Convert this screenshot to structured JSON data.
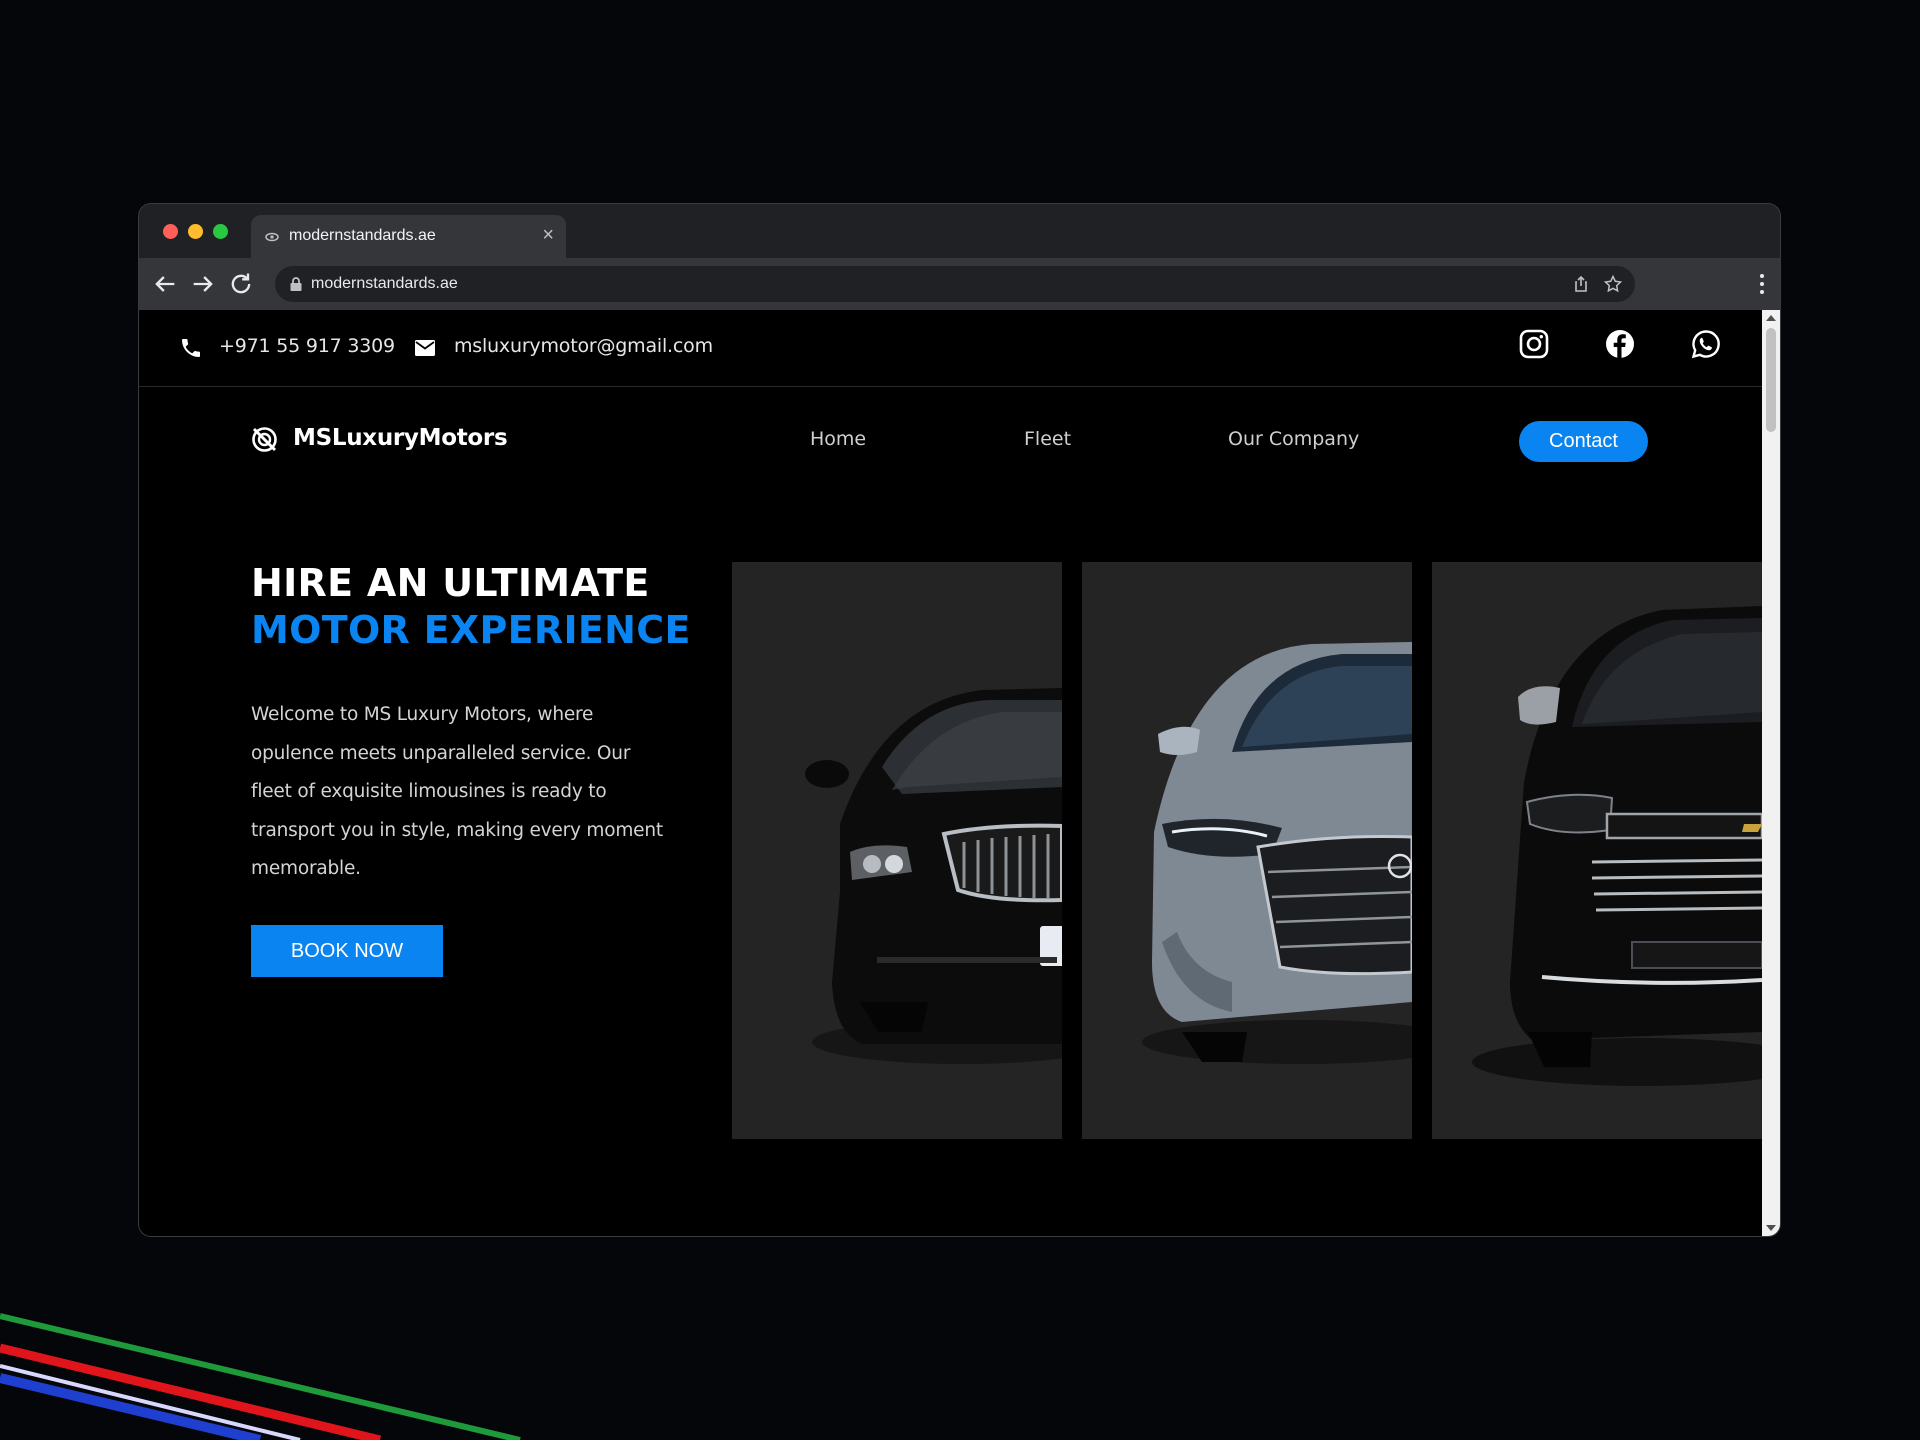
{
  "browser": {
    "tab_title": "modernstandards.ae",
    "url": "modernstandards.ae"
  },
  "topbar": {
    "phone": "+971 55 917 3309",
    "email": "msluxurymotor@gmail.com",
    "socials": [
      "instagram-icon",
      "facebook-icon",
      "whatsapp-icon"
    ]
  },
  "header": {
    "logo": "MSLuxuryMotors",
    "nav": [
      {
        "label": "Home"
      },
      {
        "label": "Fleet"
      },
      {
        "label": "Our Company"
      }
    ],
    "contact_label": "Contact"
  },
  "hero": {
    "title_line1": "HIRE AN ULTIMATE",
    "title_line2": "MOTOR EXPERIENCE",
    "description": "Welcome to MS Luxury Motors, where opulence meets unparalleled service. Our fleet of exquisite limousines is ready to transport you in style, making every moment memorable.",
    "cta": "BOOK NOW"
  },
  "fleet_cards": [
    {
      "name": "black-limousine-image"
    },
    {
      "name": "silver-sedan-image"
    },
    {
      "name": "black-suv-image"
    }
  ],
  "colors": {
    "accent": "#0a84f0",
    "background": "#000000",
    "card": "#242424"
  }
}
